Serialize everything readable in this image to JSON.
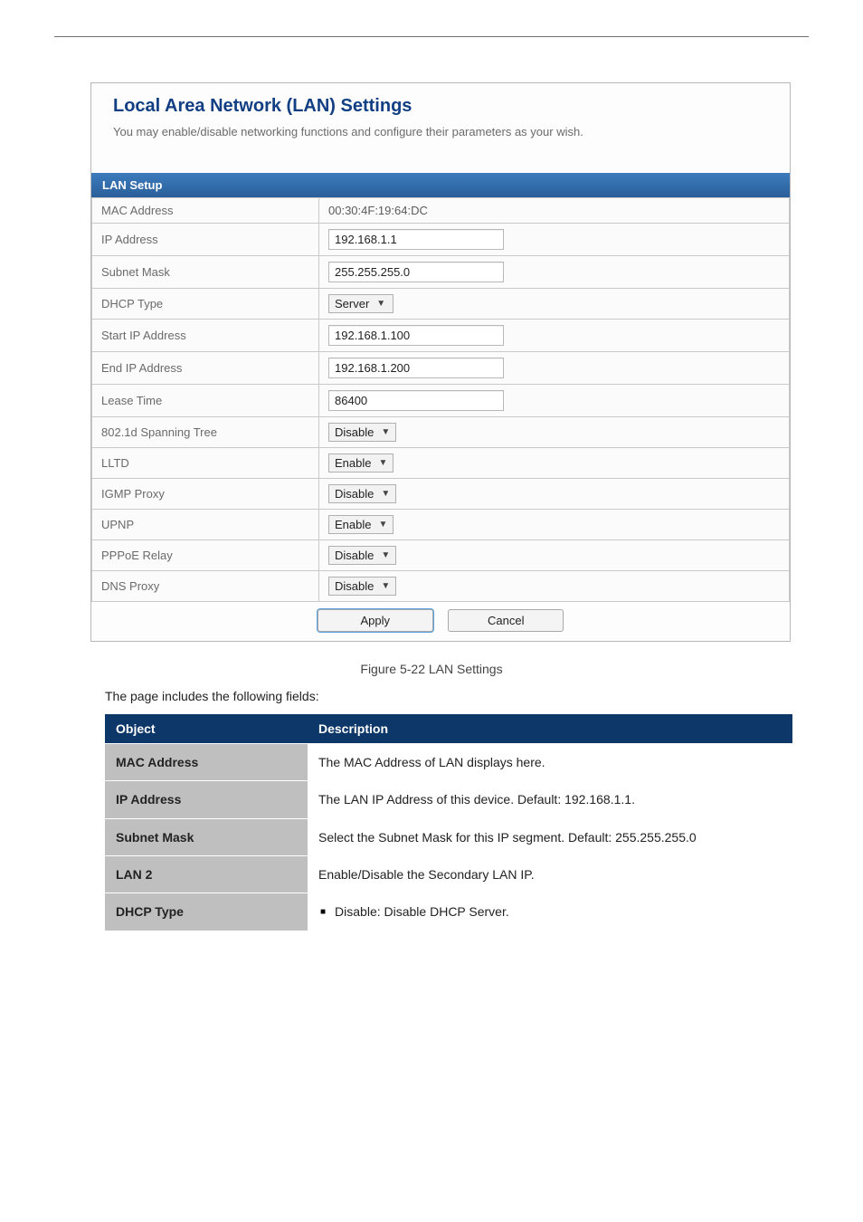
{
  "panel": {
    "title": "Local Area Network (LAN) Settings",
    "description": "You may enable/disable networking functions and configure their parameters as your wish.",
    "section_header": "LAN Setup",
    "rows": {
      "mac_address": {
        "label": "MAC Address",
        "value": "00:30:4F:19:64:DC"
      },
      "ip_address": {
        "label": "IP Address",
        "value": "192.168.1.1"
      },
      "subnet_mask": {
        "label": "Subnet Mask",
        "value": "255.255.255.0"
      },
      "dhcp_type": {
        "label": "DHCP Type",
        "value": "Server"
      },
      "start_ip": {
        "label": "Start IP Address",
        "value": "192.168.1.100"
      },
      "end_ip": {
        "label": "End IP Address",
        "value": "192.168.1.200"
      },
      "lease_time": {
        "label": "Lease Time",
        "value": "86400"
      },
      "spanning_tree": {
        "label": "802.1d Spanning Tree",
        "value": "Disable"
      },
      "lltd": {
        "label": "LLTD",
        "value": "Enable"
      },
      "igmp_proxy": {
        "label": "IGMP Proxy",
        "value": "Disable"
      },
      "upnp": {
        "label": "UPNP",
        "value": "Enable"
      },
      "pppoe_relay": {
        "label": "PPPoE Relay",
        "value": "Disable"
      },
      "dns_proxy": {
        "label": "DNS Proxy",
        "value": "Disable"
      }
    },
    "buttons": {
      "apply": "Apply",
      "cancel": "Cancel"
    }
  },
  "caption": "Figure 5-22 LAN Settings",
  "intro": "The page includes the following fields:",
  "table": {
    "headers": {
      "object": "Object",
      "description": "Description"
    },
    "rows": [
      {
        "object": "MAC Address",
        "description": "The MAC Address of LAN displays here."
      },
      {
        "object": "IP Address",
        "description": "The LAN IP Address of this device. Default: 192.168.1.1."
      },
      {
        "object": "Subnet Mask",
        "description": "Select the Subnet Mask for this IP segment. Default: 255.255.255.0"
      },
      {
        "object": "LAN 2",
        "description": "Enable/Disable the Secondary LAN IP."
      },
      {
        "object": "DHCP Type",
        "bullet": "Disable: Disable DHCP Server."
      }
    ]
  }
}
